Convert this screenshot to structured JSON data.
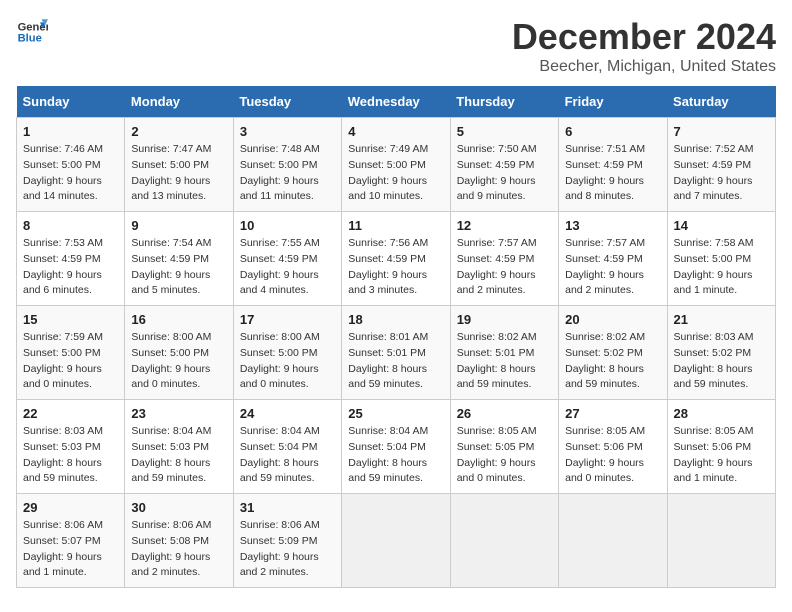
{
  "header": {
    "logo_line1": "General",
    "logo_line2": "Blue",
    "month": "December 2024",
    "location": "Beecher, Michigan, United States"
  },
  "weekdays": [
    "Sunday",
    "Monday",
    "Tuesday",
    "Wednesday",
    "Thursday",
    "Friday",
    "Saturday"
  ],
  "weeks": [
    [
      {
        "day": "1",
        "info": "Sunrise: 7:46 AM\nSunset: 5:00 PM\nDaylight: 9 hours and 14 minutes."
      },
      {
        "day": "2",
        "info": "Sunrise: 7:47 AM\nSunset: 5:00 PM\nDaylight: 9 hours and 13 minutes."
      },
      {
        "day": "3",
        "info": "Sunrise: 7:48 AM\nSunset: 5:00 PM\nDaylight: 9 hours and 11 minutes."
      },
      {
        "day": "4",
        "info": "Sunrise: 7:49 AM\nSunset: 5:00 PM\nDaylight: 9 hours and 10 minutes."
      },
      {
        "day": "5",
        "info": "Sunrise: 7:50 AM\nSunset: 4:59 PM\nDaylight: 9 hours and 9 minutes."
      },
      {
        "day": "6",
        "info": "Sunrise: 7:51 AM\nSunset: 4:59 PM\nDaylight: 9 hours and 8 minutes."
      },
      {
        "day": "7",
        "info": "Sunrise: 7:52 AM\nSunset: 4:59 PM\nDaylight: 9 hours and 7 minutes."
      }
    ],
    [
      {
        "day": "8",
        "info": "Sunrise: 7:53 AM\nSunset: 4:59 PM\nDaylight: 9 hours and 6 minutes."
      },
      {
        "day": "9",
        "info": "Sunrise: 7:54 AM\nSunset: 4:59 PM\nDaylight: 9 hours and 5 minutes."
      },
      {
        "day": "10",
        "info": "Sunrise: 7:55 AM\nSunset: 4:59 PM\nDaylight: 9 hours and 4 minutes."
      },
      {
        "day": "11",
        "info": "Sunrise: 7:56 AM\nSunset: 4:59 PM\nDaylight: 9 hours and 3 minutes."
      },
      {
        "day": "12",
        "info": "Sunrise: 7:57 AM\nSunset: 4:59 PM\nDaylight: 9 hours and 2 minutes."
      },
      {
        "day": "13",
        "info": "Sunrise: 7:57 AM\nSunset: 4:59 PM\nDaylight: 9 hours and 2 minutes."
      },
      {
        "day": "14",
        "info": "Sunrise: 7:58 AM\nSunset: 5:00 PM\nDaylight: 9 hours and 1 minute."
      }
    ],
    [
      {
        "day": "15",
        "info": "Sunrise: 7:59 AM\nSunset: 5:00 PM\nDaylight: 9 hours and 0 minutes."
      },
      {
        "day": "16",
        "info": "Sunrise: 8:00 AM\nSunset: 5:00 PM\nDaylight: 9 hours and 0 minutes."
      },
      {
        "day": "17",
        "info": "Sunrise: 8:00 AM\nSunset: 5:00 PM\nDaylight: 9 hours and 0 minutes."
      },
      {
        "day": "18",
        "info": "Sunrise: 8:01 AM\nSunset: 5:01 PM\nDaylight: 8 hours and 59 minutes."
      },
      {
        "day": "19",
        "info": "Sunrise: 8:02 AM\nSunset: 5:01 PM\nDaylight: 8 hours and 59 minutes."
      },
      {
        "day": "20",
        "info": "Sunrise: 8:02 AM\nSunset: 5:02 PM\nDaylight: 8 hours and 59 minutes."
      },
      {
        "day": "21",
        "info": "Sunrise: 8:03 AM\nSunset: 5:02 PM\nDaylight: 8 hours and 59 minutes."
      }
    ],
    [
      {
        "day": "22",
        "info": "Sunrise: 8:03 AM\nSunset: 5:03 PM\nDaylight: 8 hours and 59 minutes."
      },
      {
        "day": "23",
        "info": "Sunrise: 8:04 AM\nSunset: 5:03 PM\nDaylight: 8 hours and 59 minutes."
      },
      {
        "day": "24",
        "info": "Sunrise: 8:04 AM\nSunset: 5:04 PM\nDaylight: 8 hours and 59 minutes."
      },
      {
        "day": "25",
        "info": "Sunrise: 8:04 AM\nSunset: 5:04 PM\nDaylight: 8 hours and 59 minutes."
      },
      {
        "day": "26",
        "info": "Sunrise: 8:05 AM\nSunset: 5:05 PM\nDaylight: 9 hours and 0 minutes."
      },
      {
        "day": "27",
        "info": "Sunrise: 8:05 AM\nSunset: 5:06 PM\nDaylight: 9 hours and 0 minutes."
      },
      {
        "day": "28",
        "info": "Sunrise: 8:05 AM\nSunset: 5:06 PM\nDaylight: 9 hours and 1 minute."
      }
    ],
    [
      {
        "day": "29",
        "info": "Sunrise: 8:06 AM\nSunset: 5:07 PM\nDaylight: 9 hours and 1 minute."
      },
      {
        "day": "30",
        "info": "Sunrise: 8:06 AM\nSunset: 5:08 PM\nDaylight: 9 hours and 2 minutes."
      },
      {
        "day": "31",
        "info": "Sunrise: 8:06 AM\nSunset: 5:09 PM\nDaylight: 9 hours and 2 minutes."
      },
      {
        "day": "",
        "info": ""
      },
      {
        "day": "",
        "info": ""
      },
      {
        "day": "",
        "info": ""
      },
      {
        "day": "",
        "info": ""
      }
    ]
  ]
}
